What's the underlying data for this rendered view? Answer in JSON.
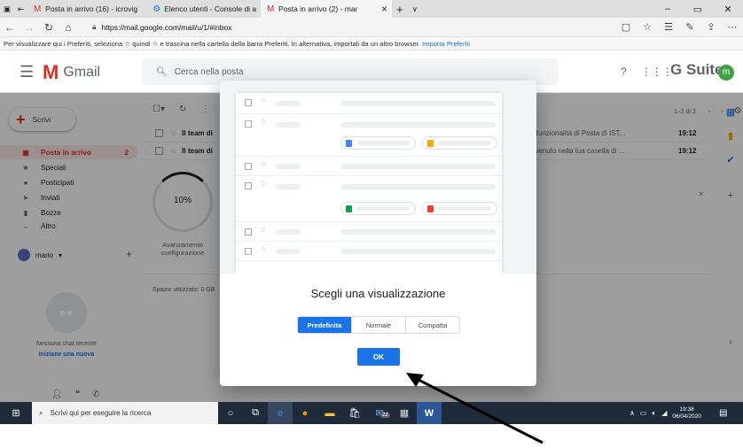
{
  "browser": {
    "tabs": [
      {
        "label": "Posta in arrivo (16) - icrovig",
        "icon": "gmail-icon"
      },
      {
        "label": "Elenco utenti - Console di a",
        "icon": "admin-icon"
      },
      {
        "label": "Posta in arrivo (2) - mar",
        "icon": "gmail-icon",
        "active": true
      }
    ],
    "new_tab": "+",
    "tab_menu": "∨",
    "url": "https://mail.google.com/mail/u/1/#inbox",
    "favorites_text": "Per visualizzare qui i Preferiti, seleziona ☆ quindi ☆ e trascina nella cartella della barra Preferiti. In alternativa, importali da un altro browser.",
    "favorites_link": "Importa Preferiti"
  },
  "gmail": {
    "logo": "Gmail",
    "search_placeholder": "Cerca nella posta",
    "gsuite": "G Suite",
    "avatar_letter": "m",
    "compose": "Scrivi",
    "nav": [
      {
        "label": "Posta in arrivo",
        "count": "2",
        "selected": true
      },
      {
        "label": "Speciali"
      },
      {
        "label": "Posticipati"
      },
      {
        "label": "Inviati"
      },
      {
        "label": "Bozze"
      },
      {
        "label": "Altro"
      }
    ],
    "user": "mario",
    "no_chat": "Nessuna chat recente",
    "new_chat": "Iniziane una nuova",
    "pager": "1–2 di 2",
    "rows": [
      {
        "sender": "Il team di",
        "snippet": "liori funzionalità di Posta di IST...",
        "time": "19:12"
      },
      {
        "sender": "Il team di",
        "snippet": "benvenuto nella tua casella di ...",
        "time": "19:12"
      }
    ],
    "progress": "10%",
    "progress_value": 0.1,
    "setup_label": "Avanzamento configurazione",
    "storage": "Spazio utilizzato: 0 GB"
  },
  "modal": {
    "title": "Scegli una visualizzazione",
    "options": [
      "Predefinita",
      "Normale",
      "Compatta"
    ],
    "selected": "Predefinita",
    "ok": "OK"
  },
  "taskbar": {
    "search_placeholder": "Scrivi qui per eseguire la ricerca",
    "time": "19:38",
    "date": "06/04/2020",
    "badge": "22"
  },
  "colors": {
    "accent": "#1a73e8",
    "gmail_red": "#d93025",
    "taskbar": "#1f2b3a"
  }
}
